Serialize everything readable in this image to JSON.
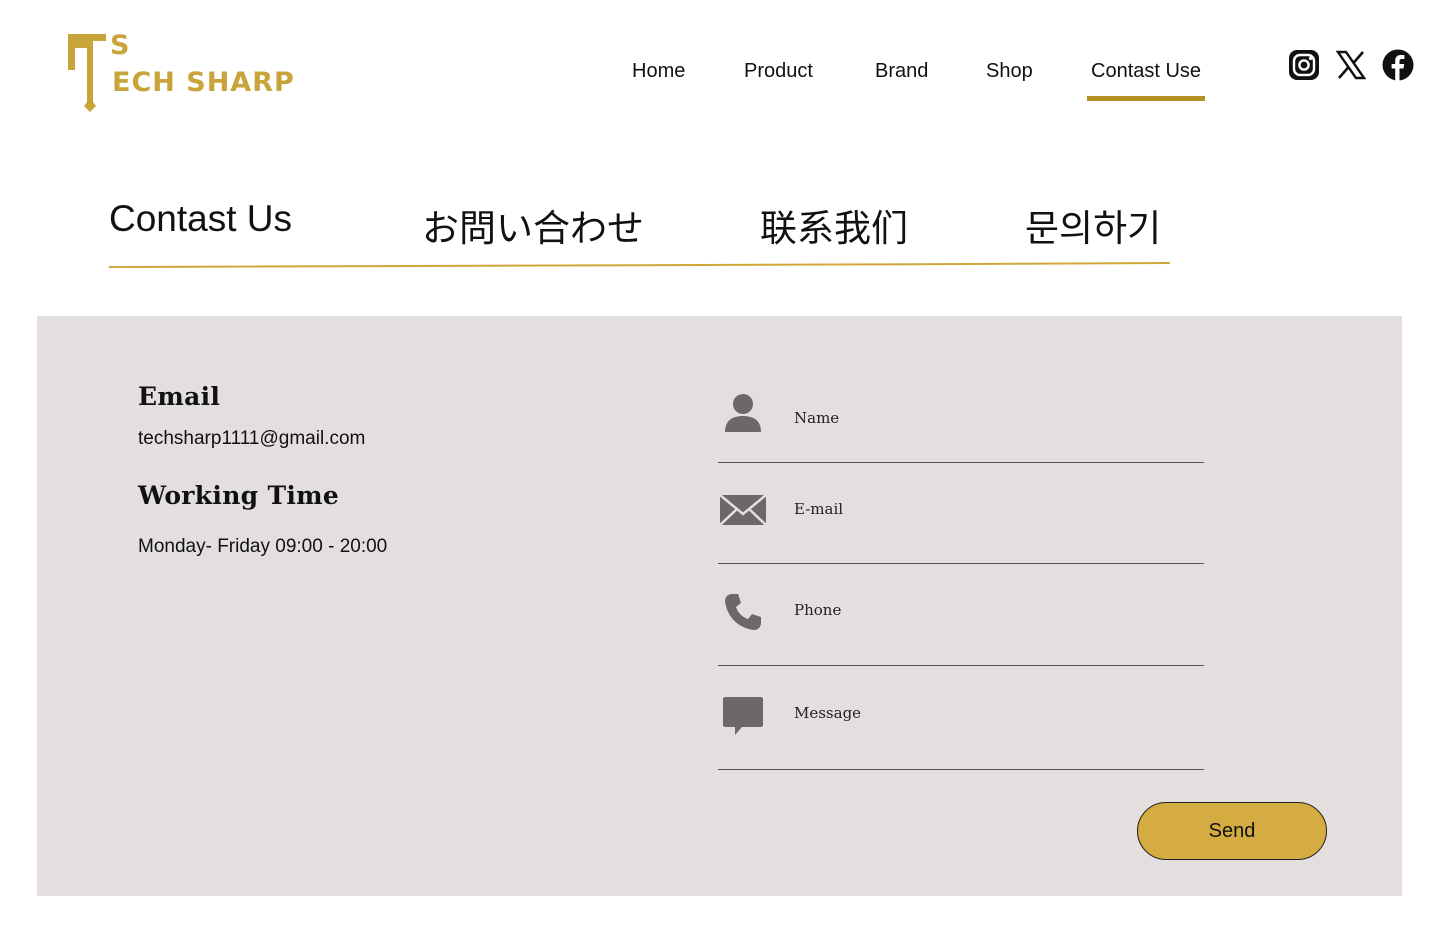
{
  "brand": {
    "logo_top": "S",
    "logo_text": "ECH SHARP",
    "accent": "#c9a43b"
  },
  "nav": {
    "items": [
      {
        "label": "Home"
      },
      {
        "label": "Product"
      },
      {
        "label": "Brand"
      },
      {
        "label": "Shop"
      },
      {
        "label": "Contast Use",
        "active": true
      }
    ],
    "active_color": "#b58e22"
  },
  "social": [
    {
      "icon": "instagram-icon"
    },
    {
      "icon": "x-icon"
    },
    {
      "icon": "facebook-icon"
    }
  ],
  "languages": [
    "Contast Us",
    "お問い合わせ",
    "联系我们",
    "문의하기"
  ],
  "info": {
    "email_heading": "Email",
    "email_value": "techsharp1111@gmail.com",
    "hours_heading": "Working Time",
    "hours_value": "Monday- Friday 09:00 - 20:00"
  },
  "form": {
    "name_placeholder": "Name",
    "email_placeholder": "E-mail",
    "phone_placeholder": "Phone",
    "message_placeholder": "Message",
    "send_label": "Send",
    "send_color": "#d4ac42",
    "panel_color": "#e4dfdf"
  }
}
